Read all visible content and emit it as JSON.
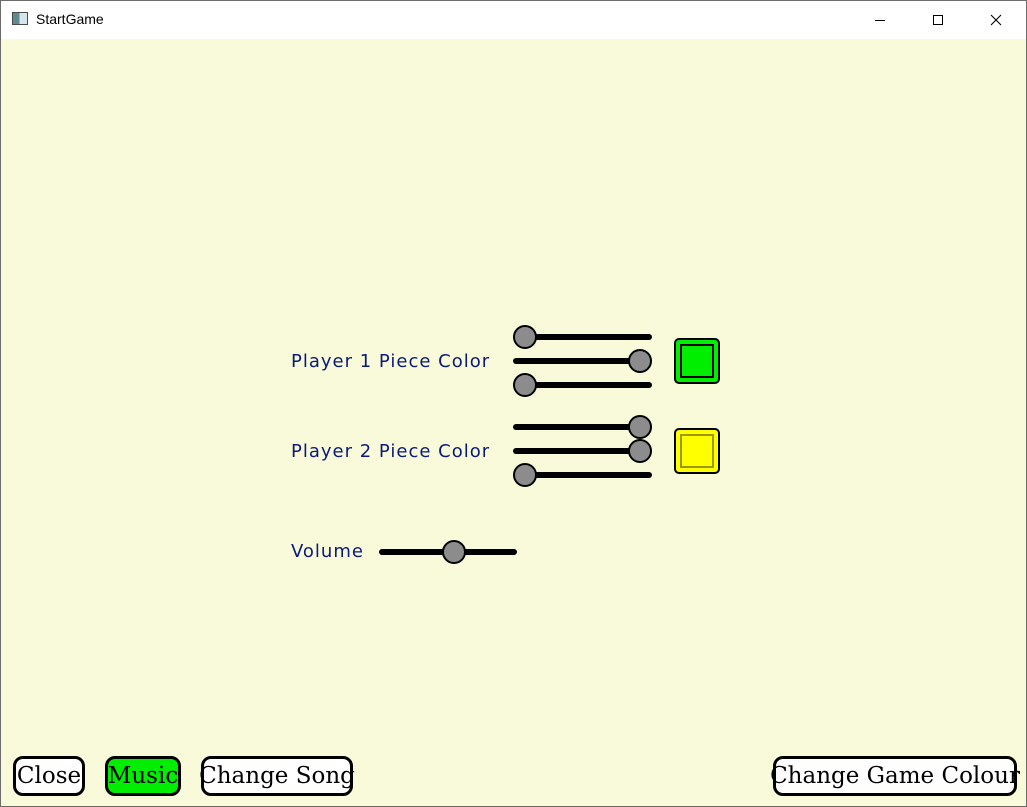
{
  "window": {
    "title": "StartGame",
    "icons": {
      "app": "app-window-icon",
      "minimize": "minimize-icon",
      "maximize": "maximize-icon",
      "close": "close-icon"
    }
  },
  "settings": {
    "player1": {
      "label": "Player 1 Piece Color",
      "sliders": [
        0.0,
        1.0,
        0.0
      ],
      "swatch_color": "#00ee00",
      "swatch_border": "#000000"
    },
    "player2": {
      "label": "Player 2 Piece Color",
      "sliders": [
        1.0,
        1.0,
        0.0
      ],
      "swatch_color": "#ffff00",
      "swatch_border": "#9a9a00"
    },
    "volume": {
      "label": "Volume",
      "value": 0.55
    }
  },
  "buttons": {
    "close": "Close",
    "music": "Music",
    "change_song": "Change Song",
    "change_colour": "Change Game Colour"
  },
  "colors": {
    "background": "#f9fad9",
    "label_text": "#0a1a7a",
    "music_active": "#00ee00",
    "slider_thumb": "#8c8c8c"
  }
}
